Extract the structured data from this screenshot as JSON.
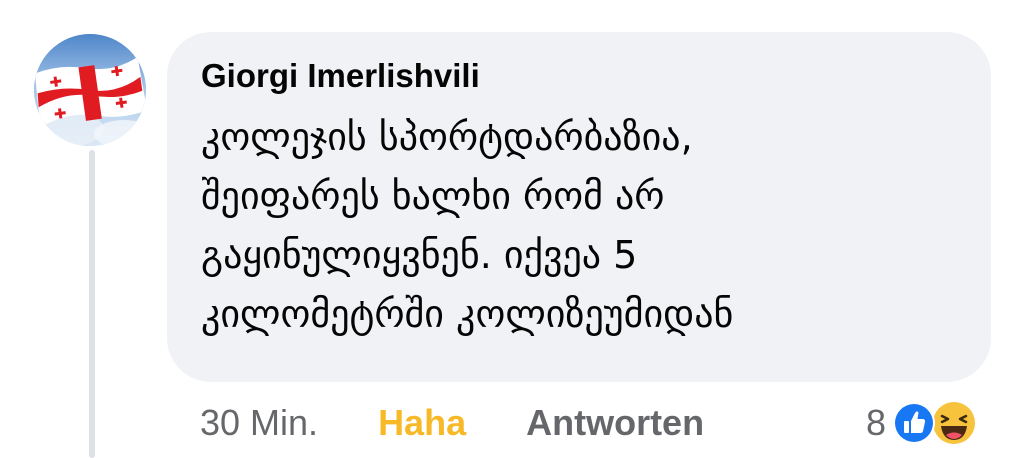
{
  "comment": {
    "author": "Giorgi Imerlishvili",
    "text": "კოლეჯის სპორტდარბაზია,\nშეიფარეს ხალხი რომ არ\nგაყინულიყვნენ. იქვეა 5\nკილომეტრში კოლიზეუმიდან",
    "timestamp": "30 Min.",
    "reaction_label": "Haha",
    "reply_label": "Antworten",
    "reaction_count": "8",
    "reactions": [
      "like-icon",
      "haha-icon"
    ]
  },
  "colors": {
    "bubble_bg": "#f0f2f5",
    "haha_accent": "#f7b928",
    "like_blue": "#1877f2",
    "meta_gray": "#65676b"
  }
}
